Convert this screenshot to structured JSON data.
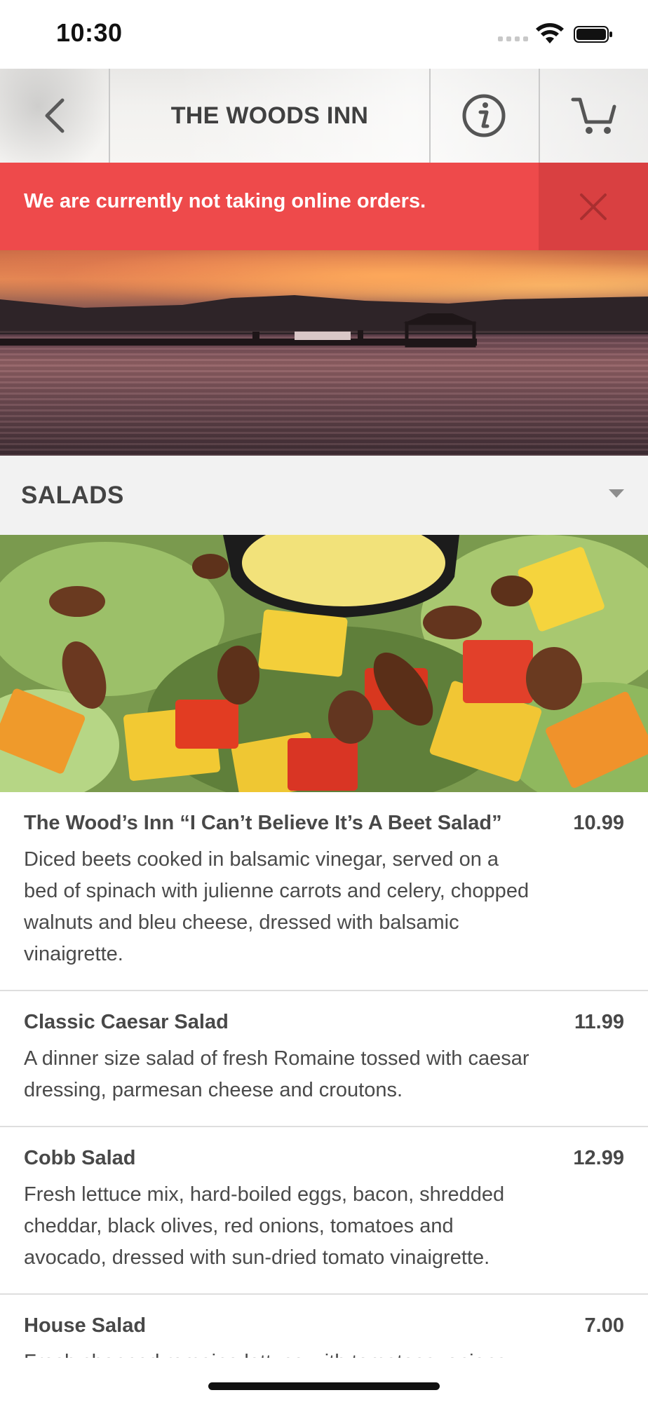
{
  "status_bar": {
    "time": "10:30"
  },
  "header": {
    "title": "THE WOODS INN"
  },
  "alert": {
    "message": "We are currently not taking online orders."
  },
  "section": {
    "title": "SALADS"
  },
  "menu_items": [
    {
      "name": "The Wood’s Inn “I Can’t Believe It’s A Beet Salad”",
      "price": "10.99",
      "description": "Diced beets cooked in balsamic vinegar, served on a bed of spinach with julienne carrots and celery, chopped walnuts and bleu cheese, dressed with balsamic vinaigrette."
    },
    {
      "name": "Classic Caesar Salad",
      "price": "11.99",
      "description": "A dinner size salad of fresh Romaine tossed with caesar dressing, parmesan cheese and croutons."
    },
    {
      "name": "Cobb Salad",
      "price": "12.99",
      "description": "Fresh lettuce mix, hard-boiled eggs, bacon, shredded cheddar, black olives, red onions, tomatoes and avocado, dressed with sun-dried tomato vinaigrette."
    },
    {
      "name": "House Salad",
      "price": "7.00",
      "description": "Fresh chopped romaine lettuce with tomatoes, onions"
    }
  ],
  "colors": {
    "alert_bg": "#ee4a4b",
    "alert_close_bg": "#d94041",
    "section_bg": "#f2f2f2"
  },
  "icons": [
    "back-chevron-icon",
    "info-icon",
    "cart-icon",
    "close-icon",
    "chevron-down-icon",
    "wifi-icon",
    "battery-icon",
    "signal-icon"
  ]
}
